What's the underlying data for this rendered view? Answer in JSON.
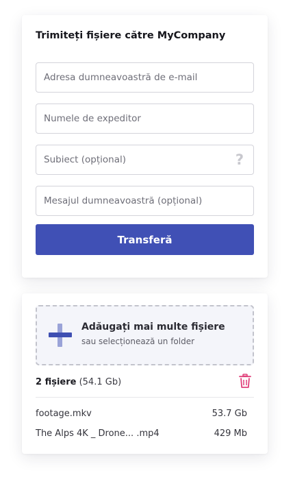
{
  "form": {
    "title": "Trimiteți fișiere către MyCompany",
    "email_placeholder": "Adresa dumneavoastră de e-mail",
    "sender_placeholder": "Numele de expeditor",
    "subject_placeholder": "Subiect (opțional)",
    "message_placeholder": "Mesajul dumneavoastră (opțional)",
    "subject_help_icon": "question-mark-icon",
    "submit_label": "Transferă"
  },
  "files": {
    "dropzone_title": "Adăugați mai multe fișiere",
    "dropzone_subtitle": "sau selecționează un folder",
    "count_label": "2 fișiere",
    "total_size": "(54.1 Gb)",
    "items": [
      {
        "name": "footage.mkv",
        "size": "53.7 Gb"
      },
      {
        "name": "The Alps 4K _ Drone... .mp4",
        "size": "429 Mb"
      }
    ]
  },
  "colors": {
    "accent": "#4050b5",
    "trash": "#e0407a",
    "help_icon": "#c8c8ce"
  }
}
